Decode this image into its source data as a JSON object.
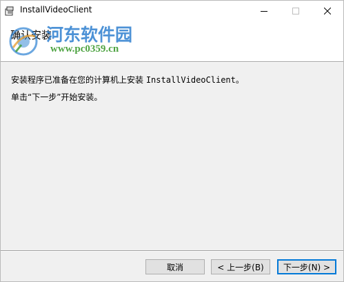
{
  "window": {
    "title": "InstallVideoClient",
    "icons": {
      "app": "installer-icon",
      "minimize": "minimize-icon",
      "maximize": "maximize-icon",
      "close": "close-icon"
    }
  },
  "header": {
    "title": "确认安装"
  },
  "watermark": {
    "name": "河东软件园",
    "url": "www.pc0359.cn"
  },
  "body": {
    "line1_prefix": "安装程序已准备在您的计算机上安装 ",
    "line1_app": "InstallVideoClient",
    "line1_suffix": "。",
    "line2": "单击“下一步”开始安装。"
  },
  "buttons": {
    "cancel": "取消",
    "back": "< 上一步(B)",
    "next": "下一步(N) >"
  },
  "colors": {
    "accent": "#0078d7",
    "watermark_text": "#2f7fcf",
    "watermark_url": "#3b9a2e"
  }
}
